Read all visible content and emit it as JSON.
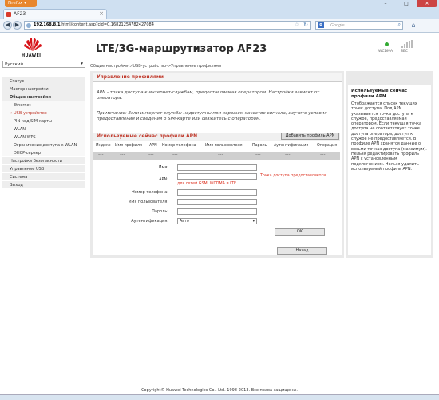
{
  "browser": {
    "app_button": "Firefox",
    "tab_title": "AF23",
    "url_host": "192.168.8.1",
    "url_path": "/html/content.asp?cid=0.16821254782427084",
    "search_engine": "g",
    "search_placeholder": "Google",
    "new_tab": "+"
  },
  "header": {
    "brand": "HUAWEI",
    "title": "LTE/3G-маршрутизатор AF23",
    "indicator_labels": [
      "WCDMA",
      "SEC"
    ]
  },
  "sidebar": {
    "language": "Русский",
    "items": [
      {
        "label": "Статус",
        "level": 0
      },
      {
        "label": "Мастер настройки",
        "level": 0
      },
      {
        "label": "Общие настройки",
        "level": 0
      },
      {
        "label": "Ethernet",
        "level": 1
      },
      {
        "label": "USB-устройство",
        "level": 1,
        "active": true
      },
      {
        "label": "PIN-код SIM-карты",
        "level": 1
      },
      {
        "label": "WLAN",
        "level": 1
      },
      {
        "label": "WLAN WPS",
        "level": 1
      },
      {
        "label": "Ограничение доступа к WLAN",
        "level": 1
      },
      {
        "label": "DHCP-сервер",
        "level": 1
      },
      {
        "label": "Настройки безопасности",
        "level": 0
      },
      {
        "label": "Управление USB",
        "level": 0
      },
      {
        "label": "Система",
        "level": 0
      },
      {
        "label": "Выход",
        "level": 0
      }
    ]
  },
  "breadcrumb": "Общие настройки->USB-устройство->Управление профилями",
  "main": {
    "title": "Управление профилями",
    "desc1": "APN - точка доступа к интернет-службам, предоставляемая оператором. Настройки зависят от оператора.",
    "desc2": "Примечание: Если интернет-службы недоступны при хорошем качестве сигнала, изучите условия предоставления и сведения о SIM-карте или свяжитесь с оператором.",
    "table_title": "Используемые сейчас профили APN",
    "add_button": "Добавить профиль APN",
    "columns": [
      "Индекс",
      "Имя профиля",
      "APN",
      "Номер телефона",
      "Имя пользователя",
      "Пароль",
      "Аутентификация",
      "Операция"
    ],
    "empty_cell": "---",
    "form": {
      "name_label": "Имя:",
      "apn_label": "APN:",
      "apn_note": "Точка доступа предоставляется",
      "apn_subnote": "для сетей GSM, WCDMA и LTE",
      "phone_label": "Номер телефона:",
      "user_label": "Имя пользователя:",
      "pass_label": "Пароль:",
      "auth_label": "Аутентификация:",
      "auth_value": "Авто",
      "ok_button": "OK"
    },
    "back_button": "Назад"
  },
  "help": {
    "title": "Используемые сейчас профили APN",
    "text": "Отображается список текущих точек доступа. Под APN указывается точка доступа к службе, предоставляемая оператором. Если текущая точка доступа не соответствует точке доступа оператора, доступ к службе не предоставляется. В профиле APN хранятся данные о восьми точках доступа (максимум). Нельзя редактировать профиль APN с установленным подключением. Нельзя удалить используемый профиль APN."
  },
  "footer": "Copyright© Huawei Technologies Co., Ltd. 1998-2013. Все права защищены.",
  "colors": {
    "accent": "#c0392b",
    "panel_bg": "#e9e9e9",
    "menu_bg": "#eeeeee",
    "firefox_orange": "#e8862c"
  }
}
